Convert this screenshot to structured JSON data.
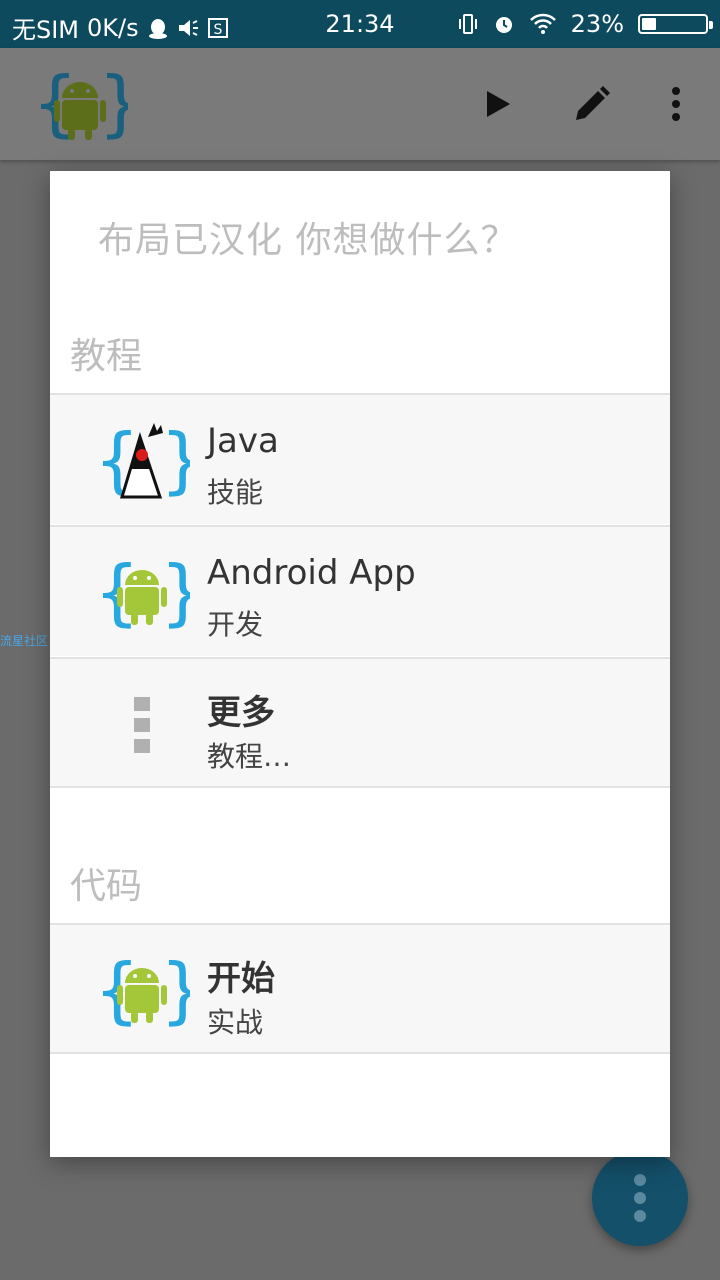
{
  "status": {
    "carrier": "无SIM",
    "speed": "0K/s",
    "time": "21:34",
    "battery": "23%",
    "battery_level": 0.23
  },
  "toolbar": {
    "icons": [
      "android-logo-icon",
      "play-icon",
      "pencil-icon",
      "overflow-menu-icon"
    ]
  },
  "side_caption": "流星社区",
  "dialog": {
    "title": "布局已汉化 你想做什么？",
    "sections": [
      {
        "header": "教程",
        "items": [
          {
            "title": "Java",
            "subtitle": "技能",
            "icon": "java-duke-icon"
          },
          {
            "title": "Android App",
            "subtitle": "开发",
            "icon": "android-icon"
          },
          {
            "title": "更多",
            "subtitle": "教程…",
            "icon": "more-dots-icon"
          }
        ]
      },
      {
        "header": "代码",
        "items": [
          {
            "title": "开始",
            "subtitle": "实战",
            "icon": "android-icon"
          }
        ]
      }
    ]
  },
  "colors": {
    "status_bar": "#0e4a5e",
    "scrim": "#6b6b6b",
    "fab": "#14506a",
    "android_green": "#a4c639",
    "bracket_blue": "#29a8e0"
  }
}
